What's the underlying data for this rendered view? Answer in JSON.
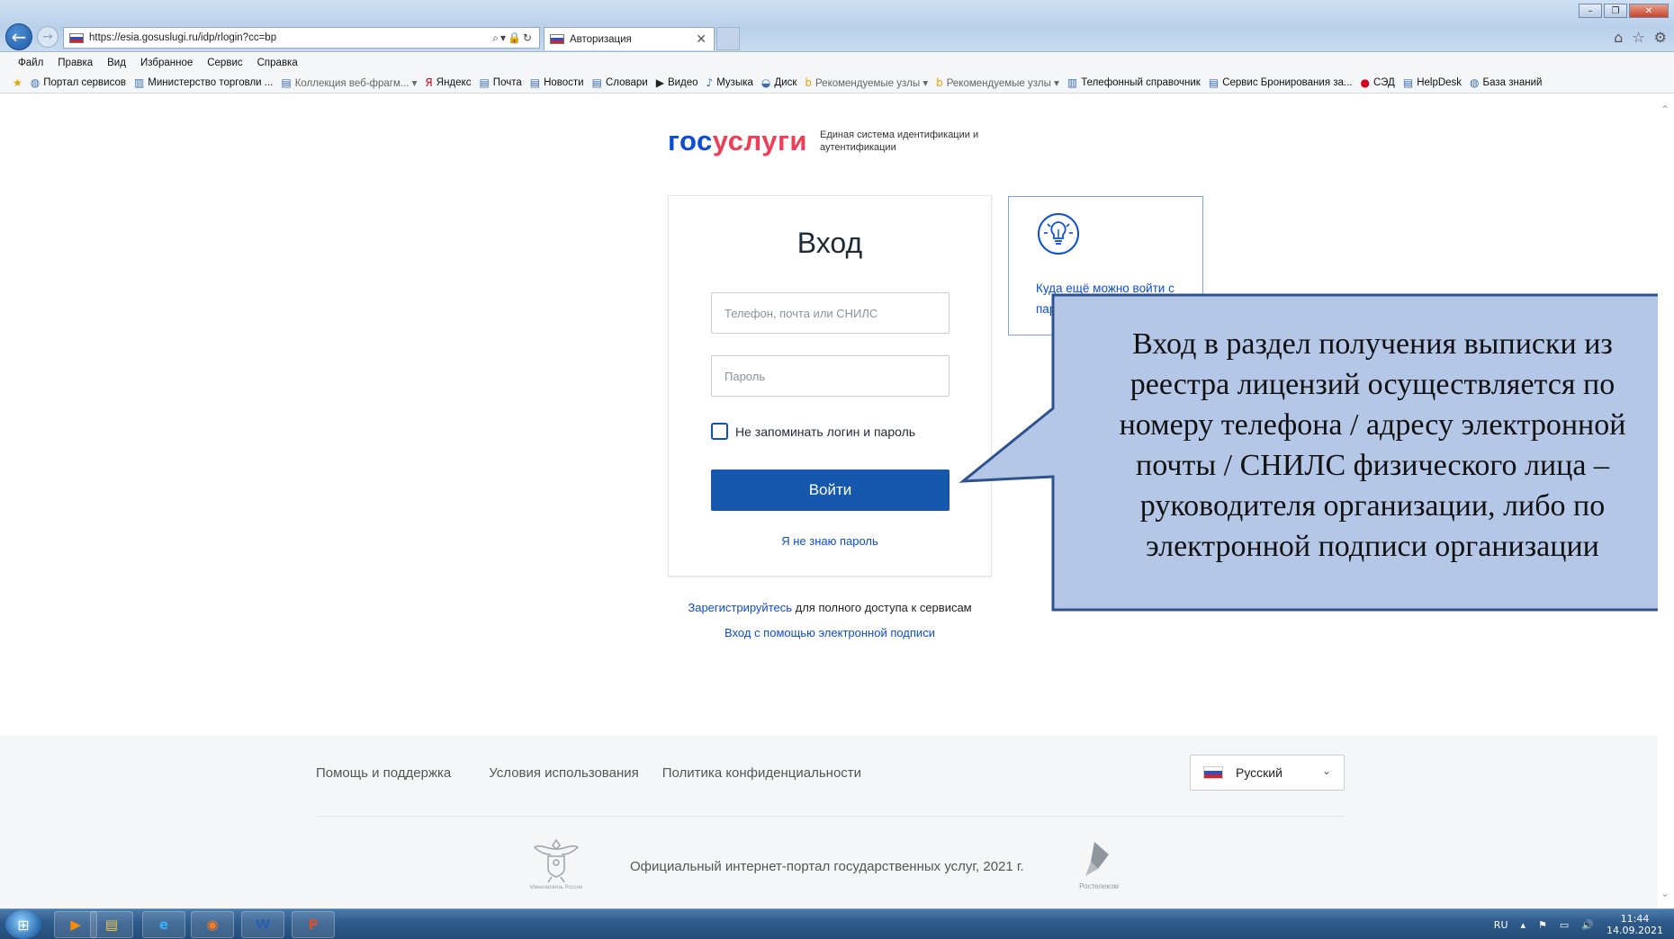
{
  "browser": {
    "url": "https://esia.gosuslugi.ru/idp/rlogin?cc=bp",
    "tab_title": "Авторизация",
    "menu": [
      "Файл",
      "Правка",
      "Вид",
      "Избранное",
      "Сервис",
      "Справка"
    ],
    "favorites": [
      {
        "label": "Портал сервисов",
        "icon": "globe-icon",
        "dim": false
      },
      {
        "label": "Министерство торговли ...",
        "icon": "chart-icon",
        "dim": false
      },
      {
        "label": "Коллекция веб-фрагм... ▾",
        "icon": "page-icon",
        "dim": true
      },
      {
        "label": "Яндекс",
        "icon": "yandex-icon",
        "dim": false
      },
      {
        "label": "Почта",
        "icon": "page-icon",
        "dim": false
      },
      {
        "label": "Новости",
        "icon": "page-icon",
        "dim": false
      },
      {
        "label": "Словари",
        "icon": "page-icon",
        "dim": false
      },
      {
        "label": "Видео",
        "icon": "video-icon",
        "dim": false
      },
      {
        "label": "Музыка",
        "icon": "music-icon",
        "dim": false
      },
      {
        "label": "Диск",
        "icon": "disk-icon",
        "dim": false
      },
      {
        "label": "Рекомендуемые узлы ▾",
        "icon": "bing-icon",
        "dim": true
      },
      {
        "label": "Рекомендуемые узлы ▾",
        "icon": "bing-icon",
        "dim": true
      },
      {
        "label": "Телефонный справочник",
        "icon": "chart-icon",
        "dim": false
      },
      {
        "label": "Сервис Бронирования за...",
        "icon": "page-icon",
        "dim": false
      },
      {
        "label": "СЭД",
        "icon": "red-icon",
        "dim": false
      },
      {
        "label": "HelpDesk",
        "icon": "page-icon",
        "dim": false
      },
      {
        "label": "База знаний",
        "icon": "globe-icon",
        "dim": false
      }
    ]
  },
  "brand": {
    "logo_part1": "гос",
    "logo_part2": "услуги",
    "subtitle": "Единая система идентификации и аутентификации"
  },
  "login": {
    "title": "Вход",
    "login_placeholder": "Телефон, почта или СНИЛС",
    "password_placeholder": "Пароль",
    "remember_label": "Не запоминать логин и пароль",
    "submit_label": "Войти",
    "forgot_label": "Я не знаю пароль"
  },
  "help_card": {
    "text": "Куда ещё можно войти с паролем от Госуслуг?"
  },
  "register": {
    "link": "Зарегистрируйтесь",
    "rest": " для полного доступа к сервисам",
    "esign_link": "Вход с помощью электронной подписи"
  },
  "callout": {
    "text": "Вход в раздел получения выписки из реестра лицензий осуществляется по номеру телефона / адресу электронной почты / СНИЛС физического лица – руководителя организации, либо по электронной подписи организации"
  },
  "footer": {
    "links": [
      "Помощь и поддержка",
      "Условия использования",
      "Политика конфиденциальности"
    ],
    "language": "Русский",
    "copyright": "Официальный интернет-портал государственных услуг, 2021 г.",
    "emblem_caption": "Минкомсвязь России",
    "partner_caption": "Ростелеком"
  },
  "taskbar": {
    "apps": [
      {
        "name": "media-player-icon",
        "glyph": "▶",
        "color": "#ff8a00"
      },
      {
        "name": "explorer-icon",
        "glyph": "▤",
        "color": "#f3c64b"
      },
      {
        "name": "ie-icon",
        "glyph": "e",
        "color": "#3ab0ff"
      },
      {
        "name": "firefox-icon",
        "glyph": "◉",
        "color": "#ff7b1c"
      },
      {
        "name": "word-icon",
        "glyph": "W",
        "color": "#2b5eaf"
      },
      {
        "name": "powerpoint-icon",
        "glyph": "P",
        "color": "#d9502c"
      }
    ],
    "lang": "RU",
    "time": "11:44",
    "date": "14.09.2021"
  },
  "colors": {
    "brand_blue": "#0d4cd3",
    "brand_red": "#ee3f58",
    "button_blue": "#1558ad",
    "callout_fill": "#b4c7e7",
    "callout_border": "#2f528f"
  }
}
